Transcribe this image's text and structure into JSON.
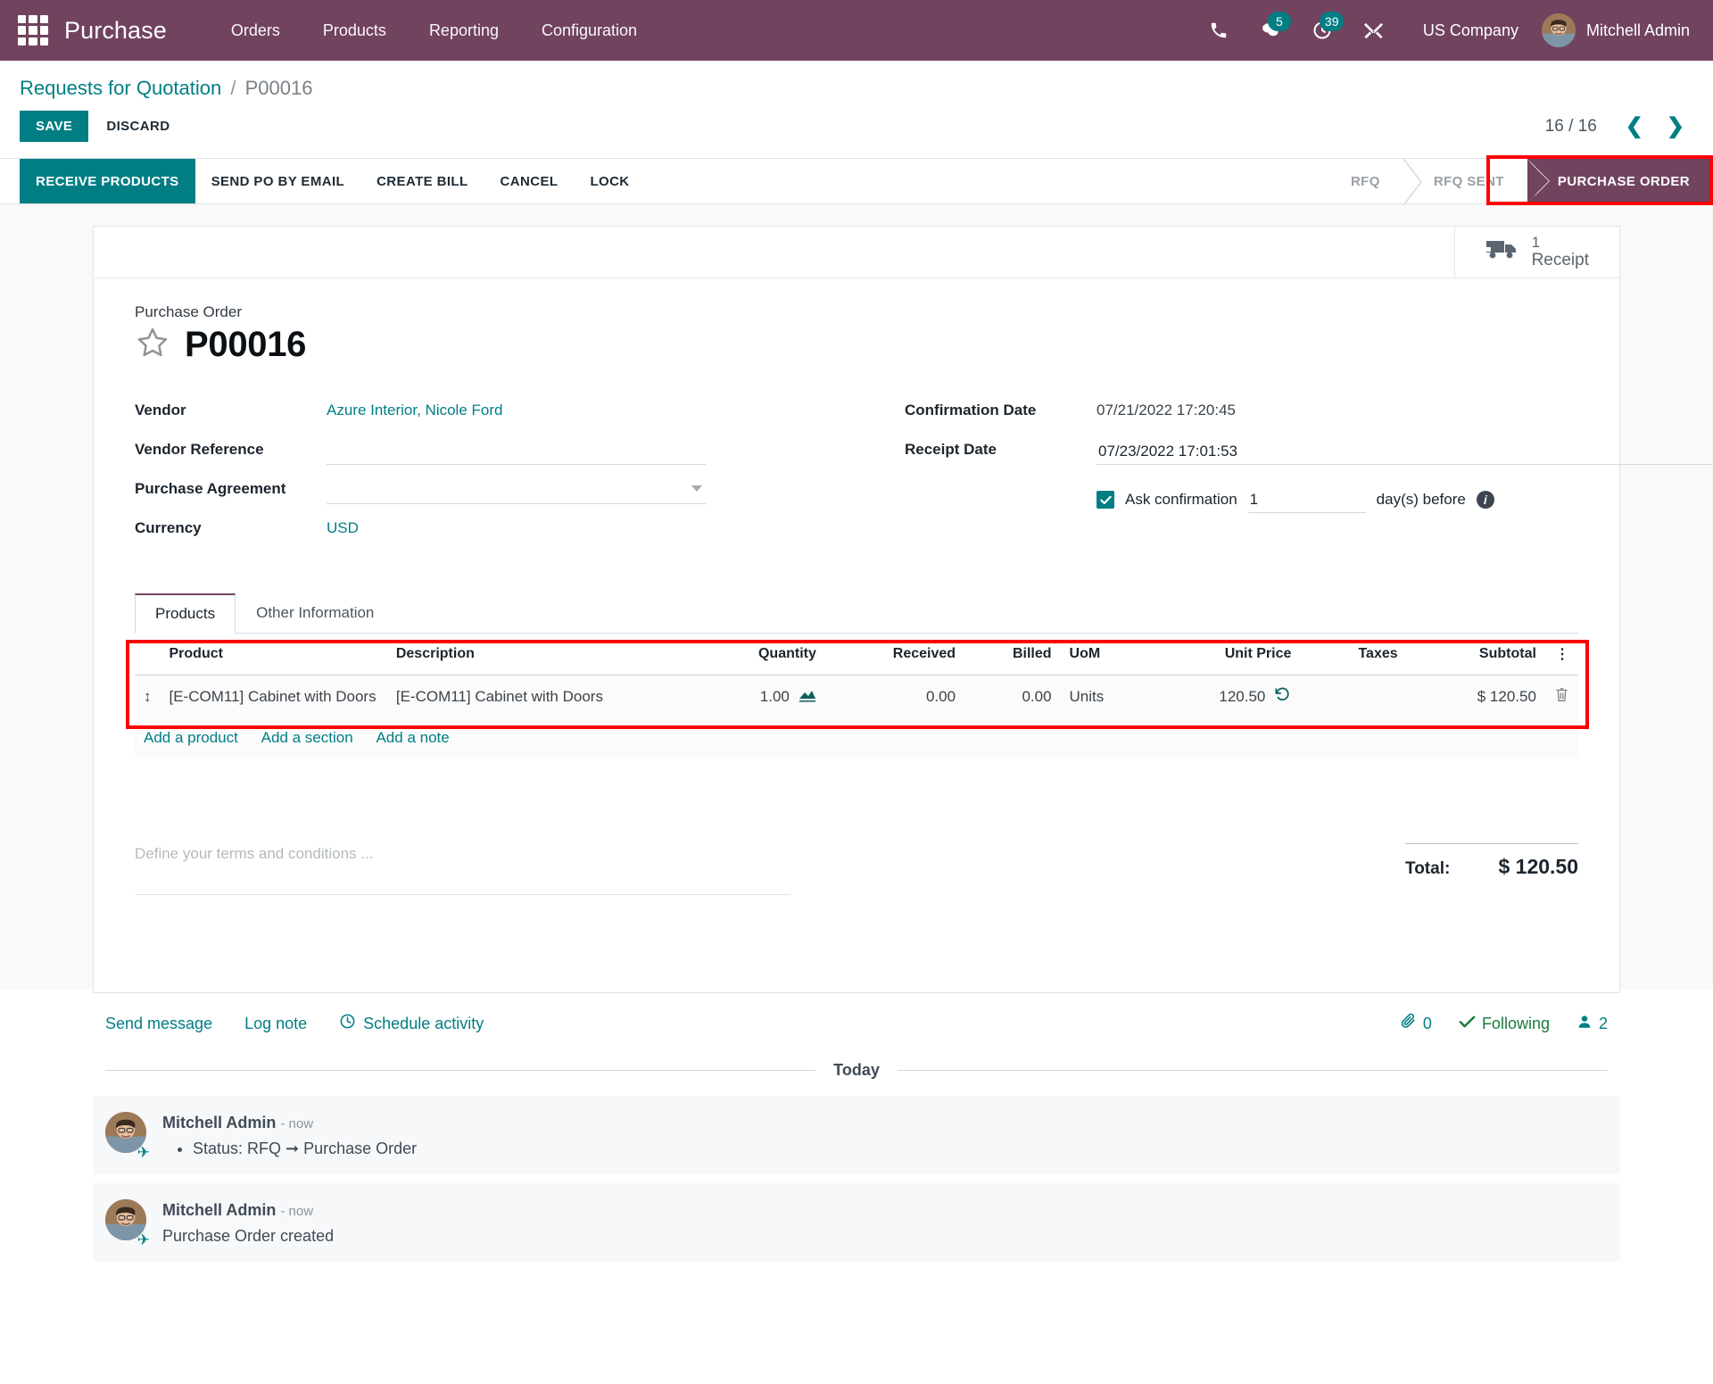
{
  "navbar": {
    "apps_icon": "apps-grid-icon",
    "brand": "Purchase",
    "menu": [
      {
        "label": "Orders"
      },
      {
        "label": "Products"
      },
      {
        "label": "Reporting"
      },
      {
        "label": "Configuration"
      }
    ],
    "icons": [
      {
        "name": "phone-icon",
        "badge": null
      },
      {
        "name": "messages-icon",
        "badge": "5"
      },
      {
        "name": "activities-clock-icon",
        "badge": "39"
      },
      {
        "name": "debug-tools-icon",
        "badge": null
      }
    ],
    "company": "US Company",
    "user": "Mitchell Admin"
  },
  "breadcrumb": {
    "root": "Requests for Quotation",
    "separator": "/",
    "current": "P00016"
  },
  "controls": {
    "save_label": "SAVE",
    "discard_label": "DISCARD",
    "pager": "16 / 16",
    "prev_icon": "chevron-left-icon",
    "next_icon": "chevron-right-icon"
  },
  "actions": [
    {
      "label": "RECEIVE PRODUCTS",
      "primary": true
    },
    {
      "label": "SEND PO BY EMAIL",
      "primary": false
    },
    {
      "label": "CREATE BILL",
      "primary": false
    },
    {
      "label": "CANCEL",
      "primary": false
    },
    {
      "label": "LOCK",
      "primary": false
    }
  ],
  "statusbar": [
    {
      "label": "RFQ",
      "active": false
    },
    {
      "label": "RFQ SENT",
      "active": false
    },
    {
      "label": "PURCHASE ORDER",
      "active": true
    }
  ],
  "stat_buttons": [
    {
      "icon": "truck-icon",
      "value": "1",
      "label": "Receipt"
    }
  ],
  "form": {
    "title_label": "Purchase Order",
    "title": "P00016",
    "star_icon": "star-outline-icon",
    "left_fields": [
      {
        "label": "Vendor",
        "value": "Azure Interior, Nicole Ford",
        "type": "link"
      },
      {
        "label": "Vendor Reference",
        "value": "",
        "placeholder": "",
        "type": "input"
      },
      {
        "label": "Purchase Agreement",
        "value": "",
        "placeholder": "",
        "type": "select"
      },
      {
        "label": "Currency",
        "value": "USD",
        "type": "link"
      }
    ],
    "right_fields": [
      {
        "label": "Confirmation Date",
        "value": "07/21/2022 17:20:45",
        "type": "text"
      },
      {
        "label": "Receipt Date",
        "value": "07/23/2022 17:01:53",
        "type": "date"
      }
    ],
    "ask_confirmation": {
      "checked": true,
      "label": "Ask confirmation",
      "days": "1",
      "suffix": "day(s) before",
      "info_icon": "info-icon"
    }
  },
  "notebook": {
    "tabs": [
      {
        "label": "Products",
        "active": true
      },
      {
        "label": "Other Information",
        "active": false
      }
    ],
    "columns": [
      "Product",
      "Description",
      "Quantity",
      "Received",
      "Billed",
      "UoM",
      "Unit Price",
      "Taxes",
      "Subtotal"
    ],
    "optional_col_icon": "options-dots-icon",
    "rows": [
      {
        "handle_icon": "drag-handle-icon",
        "product": "[E-COM11] Cabinet with Doors",
        "description": "[E-COM11] Cabinet with Doors",
        "quantity": "1.00",
        "quantity_icon": "forecast-chart-icon",
        "received": "0.00",
        "billed": "0.00",
        "uom": "Units",
        "unit_price": "120.50",
        "price_icon": "history-revert-icon",
        "taxes": "",
        "subtotal": "$ 120.50",
        "delete_icon": "trash-icon"
      }
    ],
    "add_links": [
      "Add a product",
      "Add a section",
      "Add a note"
    ]
  },
  "terms": {
    "placeholder": "Define your terms and conditions ...",
    "value": ""
  },
  "totals": {
    "label": "Total:",
    "value": "$ 120.50"
  },
  "chatter": {
    "send_message": "Send message",
    "log_note": "Log note",
    "schedule_activity": "Schedule activity",
    "schedule_icon": "clock-icon",
    "attachments": {
      "icon": "paperclip-icon",
      "count": "0"
    },
    "following": {
      "icon": "check-icon",
      "label": "Following"
    },
    "followers": {
      "icon": "user-icon",
      "count": "2"
    },
    "day_divider": "Today",
    "messages": [
      {
        "author": "Mitchell Admin",
        "time": "- now",
        "bullet": "Status: RFQ ➞ Purchase Order",
        "body": ""
      },
      {
        "author": "Mitchell Admin",
        "time": "- now",
        "bullet": "",
        "body": "Purchase Order created"
      }
    ]
  },
  "colors": {
    "brand_purple": "#71435f",
    "accent_teal": "#017e84",
    "annotation_red": "#ff0000",
    "following_green": "#1a7a3c"
  }
}
